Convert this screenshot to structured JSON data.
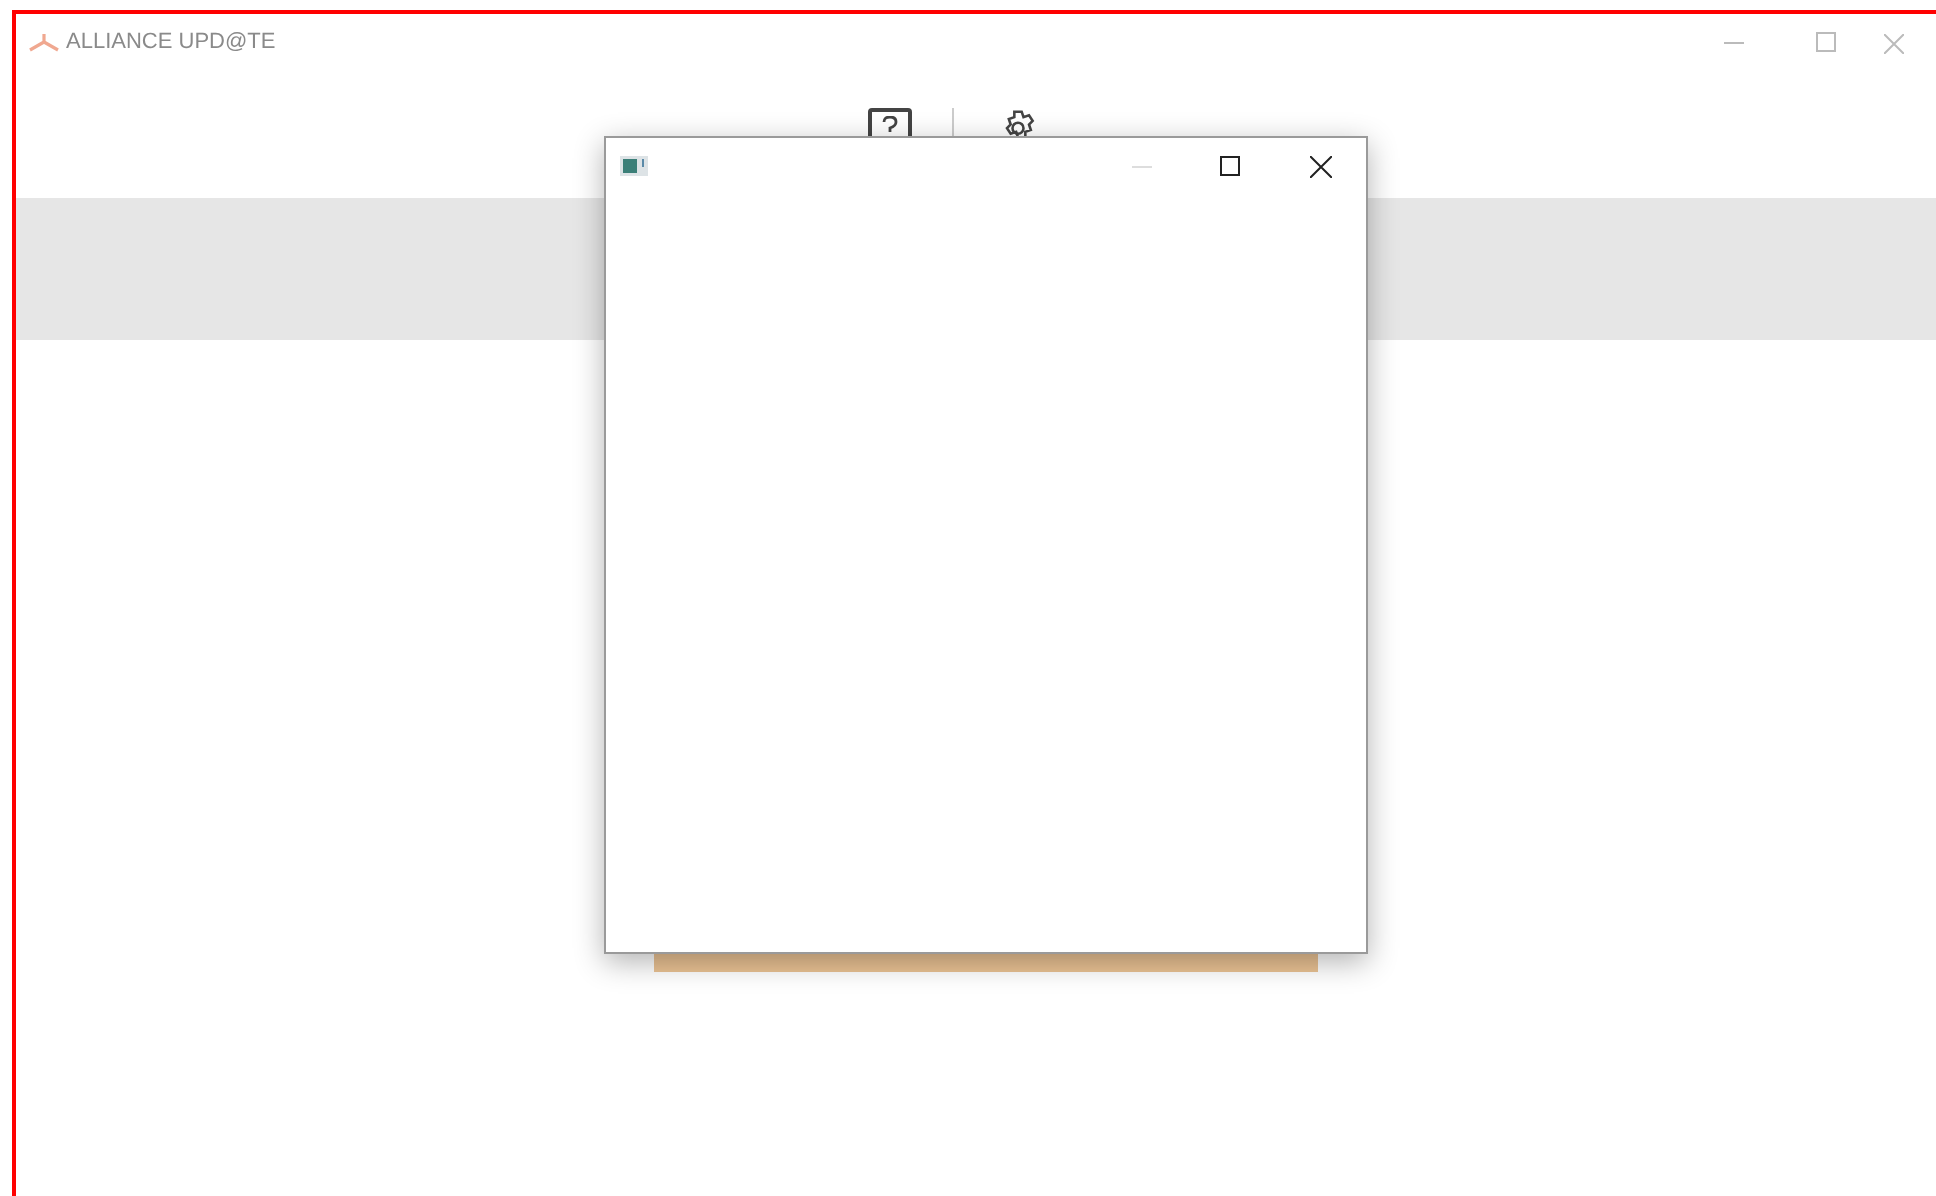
{
  "window": {
    "title": "ALLIANCE UPD@TE"
  },
  "dialog": {
    "minimize": {
      "disabled": true
    }
  }
}
